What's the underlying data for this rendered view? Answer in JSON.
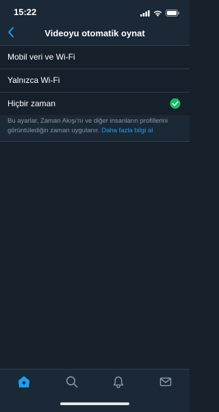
{
  "status_bar": {
    "time": "15:22"
  },
  "header": {
    "title": "Videoyu otomatik oynat",
    "back_icon": "chevron-left-icon"
  },
  "options": [
    {
      "label": "Mobil veri ve Wi-Fi",
      "selected": false
    },
    {
      "label": "Yalnızca Wi-Fi",
      "selected": false
    },
    {
      "label": "Hiçbir zaman",
      "selected": true
    }
  ],
  "note": {
    "text": "Bu ayarlar, Zaman Akışı'nı ve diğer insanların profillerini görüntülediğin zaman uygulanır.",
    "link": "Daha fazla bilgi al"
  },
  "tabs": [
    {
      "icon": "home-icon",
      "active": true
    },
    {
      "icon": "search-icon",
      "active": false
    },
    {
      "icon": "bell-icon",
      "active": false
    },
    {
      "icon": "mail-icon",
      "active": false
    }
  ],
  "colors": {
    "background": "#15202b",
    "bar": "#1b2836",
    "accent": "#1da1f2",
    "check": "#17bf63",
    "muted": "#8899a6"
  }
}
